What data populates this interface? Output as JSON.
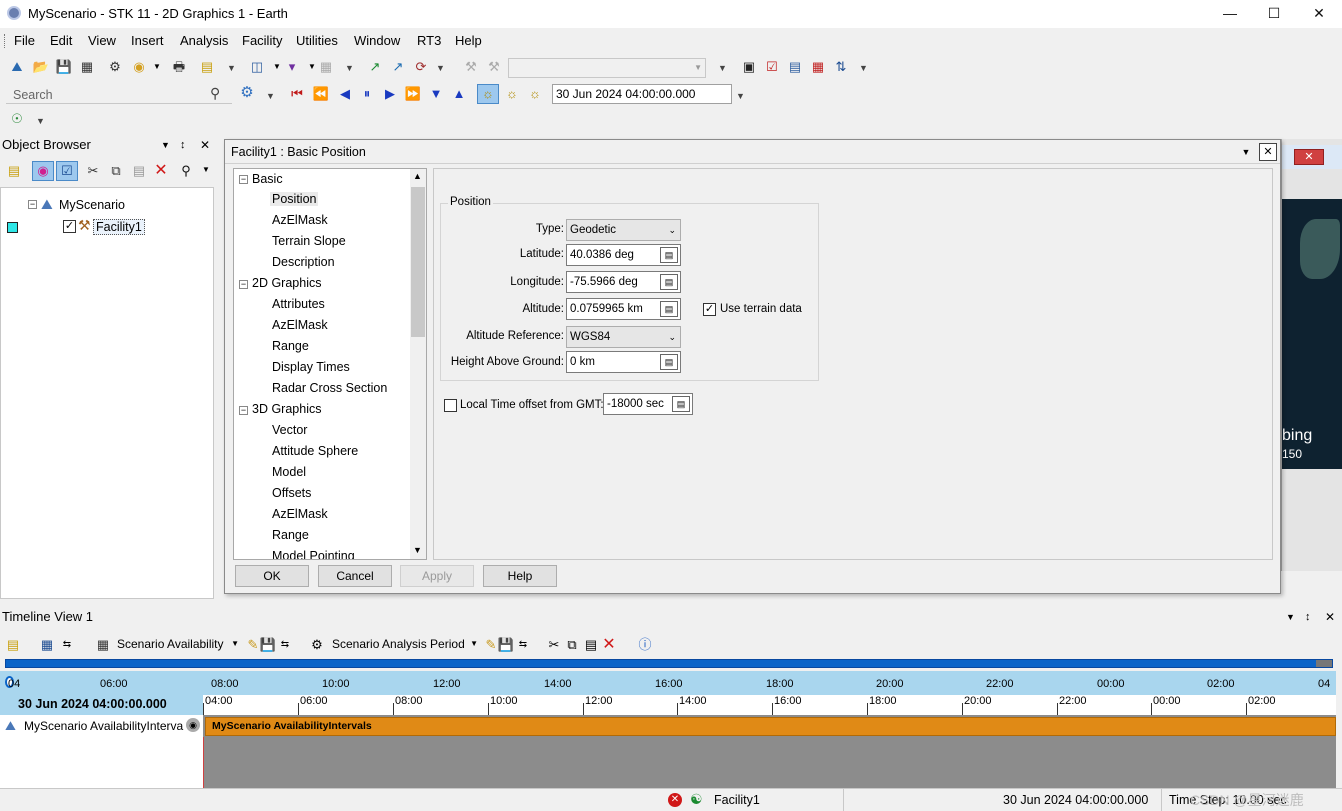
{
  "window": {
    "title": "MyScenario - STK 11 - 2D Graphics 1 - Earth"
  },
  "menu": [
    "File",
    "Edit",
    "View",
    "Insert",
    "Analysis",
    "Facility",
    "Utilities",
    "Window",
    "RT3",
    "Help"
  ],
  "toolbar": {
    "search_placeholder": "Search",
    "time": "30 Jun 2024 04:00:00.000"
  },
  "object_browser": {
    "title": "Object Browser",
    "root": "MyScenario",
    "child": "Facility1"
  },
  "dialog": {
    "title": "Facility1 : Basic Position",
    "nav": {
      "basic": "Basic",
      "basic_items": [
        "Position",
        "AzElMask",
        "Terrain Slope",
        "Description"
      ],
      "g2d": "2D Graphics",
      "g2d_items": [
        "Attributes",
        "AzElMask",
        "Range",
        "Display Times",
        "Radar Cross Section"
      ],
      "g3d": "3D Graphics",
      "g3d_items": [
        "Vector",
        "Attitude Sphere",
        "Model",
        "Offsets",
        "AzElMask",
        "Range",
        "Model Pointing"
      ]
    },
    "position": {
      "group_label": "Position",
      "type_label": "Type:",
      "type_value": "Geodetic",
      "lat_label": "Latitude:",
      "lat_value": "40.0386 deg",
      "lon_label": "Longitude:",
      "lon_value": "-75.5966 deg",
      "alt_label": "Altitude:",
      "alt_value": "0.0759965 km",
      "terrain_label": "Use terrain data",
      "altref_label": "Altitude Reference:",
      "altref_value": "WGS84",
      "hag_label": "Height Above Ground:",
      "hag_value": "0 km",
      "gmt_label": "Local Time offset from GMT:",
      "gmt_value": "-18000 sec"
    },
    "buttons": {
      "ok": "OK",
      "cancel": "Cancel",
      "apply": "Apply",
      "help": "Help"
    }
  },
  "map_overlay": {
    "text": "bing",
    "num": "150"
  },
  "timeline": {
    "title": "Timeline View 1",
    "combo1": "Scenario Availability",
    "combo2": "Scenario Analysis Period",
    "date_label": "30 Jun 2024 04:00:00.000",
    "ruler_top": [
      "04",
      "06:00",
      "08:00",
      "10:00",
      "12:00",
      "14:00",
      "16:00",
      "18:00",
      "20:00",
      "22:00",
      "00:00",
      "02:00",
      "04"
    ],
    "ruler_bottom": [
      "04:00",
      "06:00",
      "08:00",
      "10:00",
      "12:00",
      "14:00",
      "16:00",
      "18:00",
      "20:00",
      "22:00",
      "00:00",
      "02:00"
    ],
    "row_label": "MyScenario AvailabilityInterva",
    "bar_label": "MyScenario AvailabilityIntervals"
  },
  "status": {
    "object": "Facility1",
    "time": "30 Jun 2024 04:00:00.000",
    "timestep": "Time Step: 10.00 sec",
    "watermark": "CSDN @星河迷鹿"
  },
  "colors": {
    "accent": "#0a64c8",
    "bar": "#e08a16",
    "ruler": "#a9d6ee",
    "gray": "#8c8c8c"
  }
}
